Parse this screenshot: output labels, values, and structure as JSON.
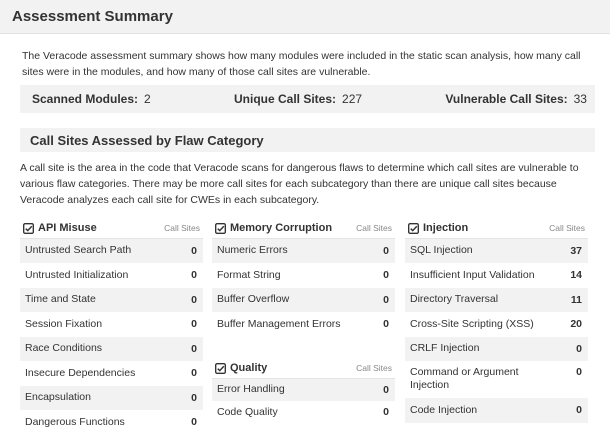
{
  "header": {
    "title": "Assessment Summary"
  },
  "intro": "The Veracode assessment summary shows how many modules were included in the static scan analysis, how many call sites were in the modules, and how many of those call sites are vulnerable.",
  "stats": {
    "scanned_label": "Scanned Modules:",
    "scanned_value": "2",
    "unique_label": "Unique Call Sites:",
    "unique_value": "227",
    "vuln_label": "Vulnerable Call Sites:",
    "vuln_value": "33"
  },
  "section": {
    "title": "Call Sites Assessed by Flaw Category",
    "description": "A call site is the area in the code that Veracode scans for dangerous flaws to determine which call sites are vulnerable to various flaw categories. There may be more call sites for each subcategory than there are unique call sites because Veracode analyzes each call site for CWEs in each subcategory."
  },
  "col_header_right": "Call Sites",
  "categories": {
    "api_misuse": {
      "title": "API Misuse",
      "items": [
        {
          "label": "Untrusted Search Path",
          "count": "0"
        },
        {
          "label": "Untrusted Initialization",
          "count": "0"
        },
        {
          "label": "Time and State",
          "count": "0"
        },
        {
          "label": "Session Fixation",
          "count": "0"
        },
        {
          "label": "Race Conditions",
          "count": "0"
        },
        {
          "label": "Insecure Dependencies",
          "count": "0"
        },
        {
          "label": "Encapsulation",
          "count": "0"
        },
        {
          "label": "Dangerous Functions",
          "count": "0"
        }
      ]
    },
    "memory_corruption": {
      "title": "Memory Corruption",
      "items": [
        {
          "label": "Numeric Errors",
          "count": "0"
        },
        {
          "label": "Format String",
          "count": "0"
        },
        {
          "label": "Buffer Overflow",
          "count": "0"
        },
        {
          "label": "Buffer Management Errors",
          "count": "0"
        }
      ]
    },
    "quality": {
      "title": "Quality",
      "items": [
        {
          "label": "Error Handling",
          "count": "0"
        },
        {
          "label": "Code Quality",
          "count": "0"
        }
      ]
    },
    "injection": {
      "title": "Injection",
      "items": [
        {
          "label": "SQL Injection",
          "count": "37"
        },
        {
          "label": "Insufficient Input Validation",
          "count": "14"
        },
        {
          "label": "Directory Traversal",
          "count": "11"
        },
        {
          "label": "Cross-Site Scripting (XSS)",
          "count": "20"
        },
        {
          "label": "CRLF Injection",
          "count": "0"
        },
        {
          "label": "Command or Argument Injection",
          "count": "0"
        },
        {
          "label": "Code Injection",
          "count": "0"
        }
      ]
    }
  }
}
